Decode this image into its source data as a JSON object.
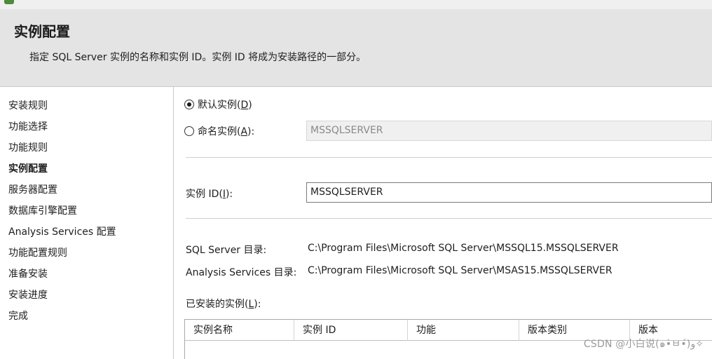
{
  "window": {
    "title_fragment": "…"
  },
  "header": {
    "title": "实例配置",
    "subtitle": "指定 SQL Server 实例的名称和实例 ID。实例 ID 将成为安装路径的一部分。"
  },
  "sidebar": {
    "items": [
      {
        "label": "安装规则"
      },
      {
        "label": "功能选择"
      },
      {
        "label": "功能规则"
      },
      {
        "label": "实例配置",
        "active": true
      },
      {
        "label": "服务器配置"
      },
      {
        "label": "数据库引擎配置"
      },
      {
        "label": "Analysis Services 配置"
      },
      {
        "label": "功能配置规则"
      },
      {
        "label": "准备安装"
      },
      {
        "label": "安装进度"
      },
      {
        "label": "完成"
      }
    ]
  },
  "instance": {
    "default_radio": {
      "text": "默认实例(",
      "key": "D",
      "suffix": ")",
      "checked": true
    },
    "named_radio": {
      "text": "命名实例(",
      "key": "A",
      "suffix": "):",
      "checked": false
    },
    "named_value": "MSSQLSERVER",
    "id_label": {
      "text": "实例 ID(",
      "key": "I",
      "suffix": "):"
    },
    "id_value": "MSSQLSERVER"
  },
  "directories": {
    "sql_label": "SQL Server 目录:",
    "sql_path": "C:\\Program Files\\Microsoft SQL Server\\MSSQL15.MSSQLSERVER",
    "as_label": "Analysis Services 目录:",
    "as_path": "C:\\Program Files\\Microsoft SQL Server\\MSAS15.MSSQLSERVER"
  },
  "installed": {
    "label": {
      "text": "已安装的实例(",
      "key": "L",
      "suffix": "):"
    },
    "columns": [
      "实例名称",
      "实例 ID",
      "功能",
      "版本类别",
      "版本"
    ]
  },
  "watermark": "CSDN @小白说(๑•̀ㅂ•́)و✧"
}
